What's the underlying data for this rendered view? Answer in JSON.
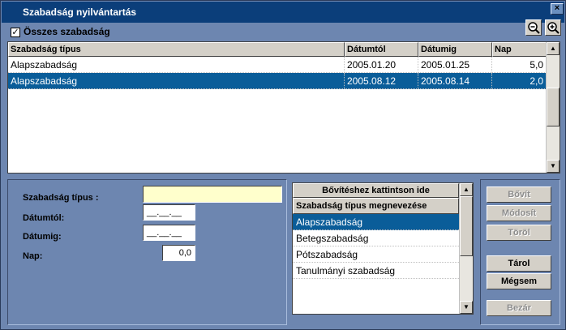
{
  "window": {
    "title": "Szabadság nyilvántartás",
    "close_symbol": "×"
  },
  "filter": {
    "all_label": "Összes szabadság",
    "all_checked": true,
    "check_mark": "✓"
  },
  "grid": {
    "columns": [
      "Szabadság típus",
      "Dátumtól",
      "Dátumig",
      "Nap"
    ],
    "rows": [
      {
        "type": "Alapszabadság",
        "from": "2005.01.20",
        "to": "2005.01.25",
        "days": "5,0",
        "selected": false
      },
      {
        "type": "Alapszabadság",
        "from": "2005.08.12",
        "to": "2005.08.14",
        "days": "2,0",
        "selected": true
      }
    ]
  },
  "form": {
    "type_label": "Szabadság típus :",
    "from_label": "Dátumtól:",
    "to_label": "Dátumig:",
    "days_label": "Nap:",
    "type_value": "",
    "from_value": "__.__.__",
    "to_value": "__.__.__",
    "days_value": "0,0"
  },
  "lookup": {
    "expand_hint": "Bővítéshez kattintson ide",
    "column": "Szabadság típus megnevezése",
    "items": [
      "Alapszabadság",
      "Betegszabadság",
      "Pótszabadság",
      "Tanulmányi szabadság"
    ],
    "selected_index": 0
  },
  "actions": {
    "add": "Bővít",
    "edit": "Módosít",
    "delete": "Töröl",
    "save": "Tárol",
    "cancel": "Mégsem",
    "close": "Bezár"
  },
  "colors": {
    "selection": "#0a5d99",
    "window_bg": "#6d86b0",
    "title_bg": "#0b3e7a",
    "input_highlight": "#ffffcc"
  },
  "icons": [
    "zoom-out-icon",
    "zoom-in-icon",
    "arrow-up-icon",
    "arrow-down-icon",
    "checkbox-check-icon"
  ]
}
